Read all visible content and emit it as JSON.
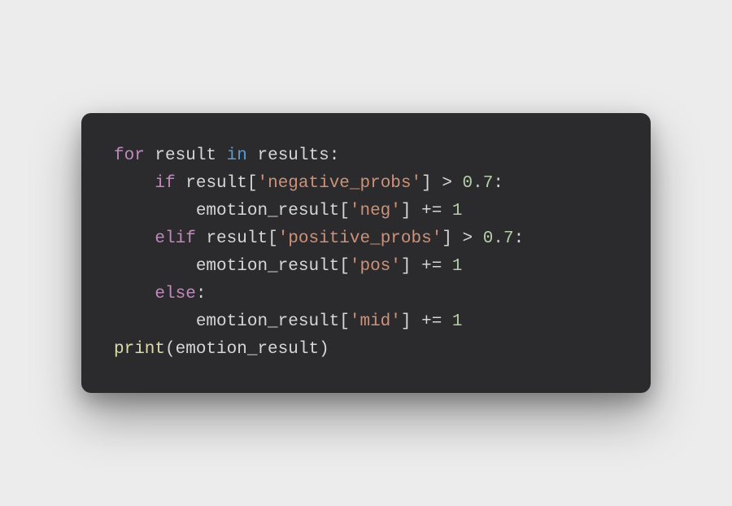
{
  "code": {
    "indent1": "    ",
    "indent2": "        ",
    "indent3": "            ",
    "for_kw": "for",
    "result_var": "result",
    "in_kw": "in",
    "results_var": "results",
    "colon": ":",
    "if_kw": "if",
    "lbrack": "[",
    "rbrack": "]",
    "neg_key": "'negative_probs'",
    "gt_op": " > ",
    "threshold": "0.7",
    "emotion_var": "emotion_result",
    "neg_short": "'neg'",
    "pluseq": " += ",
    "one": "1",
    "elif_kw": "elif",
    "pos_key": "'positive_probs'",
    "pos_short": "'pos'",
    "else_kw": "else",
    "mid_short": "'mid'",
    "print_fn": "print",
    "lparen": "(",
    "rparen": ")",
    "sp": " "
  }
}
